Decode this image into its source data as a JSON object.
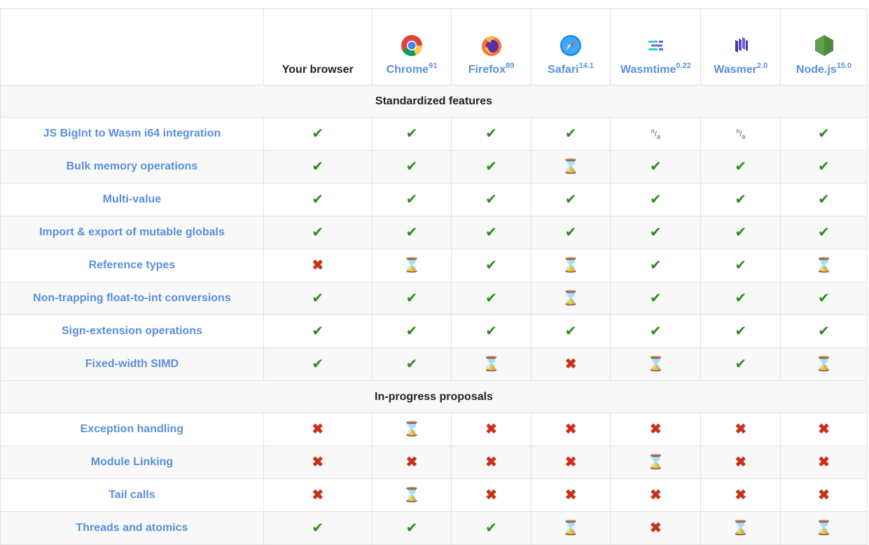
{
  "header": {
    "your_browser": "Your browser",
    "browsers": [
      {
        "name": "Chrome",
        "version": "91",
        "icon": "chrome-logo-icon"
      },
      {
        "name": "Firefox",
        "version": "89",
        "icon": "firefox-logo-icon"
      },
      {
        "name": "Safari",
        "version": "14.1",
        "icon": "safari-logo-icon"
      },
      {
        "name": "Wasmtime",
        "version": "0.22",
        "icon": "wasmtime-logo-icon"
      },
      {
        "name": "Wasmer",
        "version": "2.0",
        "icon": "wasmer-logo-icon"
      },
      {
        "name": "Node.js",
        "version": "15.0",
        "icon": "nodejs-logo-icon"
      }
    ]
  },
  "status_glyphs": {
    "yes": "✔",
    "no": "✖",
    "prog": "⌛",
    "na_top": "n",
    "na_bottom": "a"
  },
  "colors": {
    "link": "#5b8fdc",
    "yes": "#2e8b1e",
    "no": "#c9301a",
    "prog": "#b8860b",
    "stripe": "#f8f8f8"
  },
  "sections": [
    {
      "title": "Standardized features",
      "rows": [
        {
          "name": "JS BigInt to Wasm i64 integration",
          "status": [
            "yes",
            "yes",
            "yes",
            "yes",
            "na",
            "na",
            "yes"
          ]
        },
        {
          "name": "Bulk memory operations",
          "status": [
            "yes",
            "yes",
            "yes",
            "prog",
            "yes",
            "yes",
            "yes"
          ]
        },
        {
          "name": "Multi-value",
          "status": [
            "yes",
            "yes",
            "yes",
            "yes",
            "yes",
            "yes",
            "yes"
          ]
        },
        {
          "name": "Import & export of mutable globals",
          "status": [
            "yes",
            "yes",
            "yes",
            "yes",
            "yes",
            "yes",
            "yes"
          ]
        },
        {
          "name": "Reference types",
          "status": [
            "no",
            "prog",
            "yes",
            "prog",
            "yes",
            "yes",
            "prog"
          ]
        },
        {
          "name": "Non-trapping float-to-int conversions",
          "status": [
            "yes",
            "yes",
            "yes",
            "prog",
            "yes",
            "yes",
            "yes"
          ]
        },
        {
          "name": "Sign-extension operations",
          "status": [
            "yes",
            "yes",
            "yes",
            "yes",
            "yes",
            "yes",
            "yes"
          ]
        },
        {
          "name": "Fixed-width SIMD",
          "status": [
            "yes",
            "yes",
            "prog",
            "no",
            "prog",
            "yes",
            "prog"
          ]
        }
      ]
    },
    {
      "title": "In-progress proposals",
      "rows": [
        {
          "name": "Exception handling",
          "status": [
            "no",
            "prog",
            "no",
            "no",
            "no",
            "no",
            "no"
          ]
        },
        {
          "name": "Module Linking",
          "status": [
            "no",
            "no",
            "no",
            "no",
            "prog",
            "no",
            "no"
          ]
        },
        {
          "name": "Tail calls",
          "status": [
            "no",
            "prog",
            "no",
            "no",
            "no",
            "no",
            "no"
          ]
        },
        {
          "name": "Threads and atomics",
          "status": [
            "yes",
            "yes",
            "yes",
            "prog",
            "no",
            "prog",
            "prog"
          ]
        }
      ]
    }
  ]
}
